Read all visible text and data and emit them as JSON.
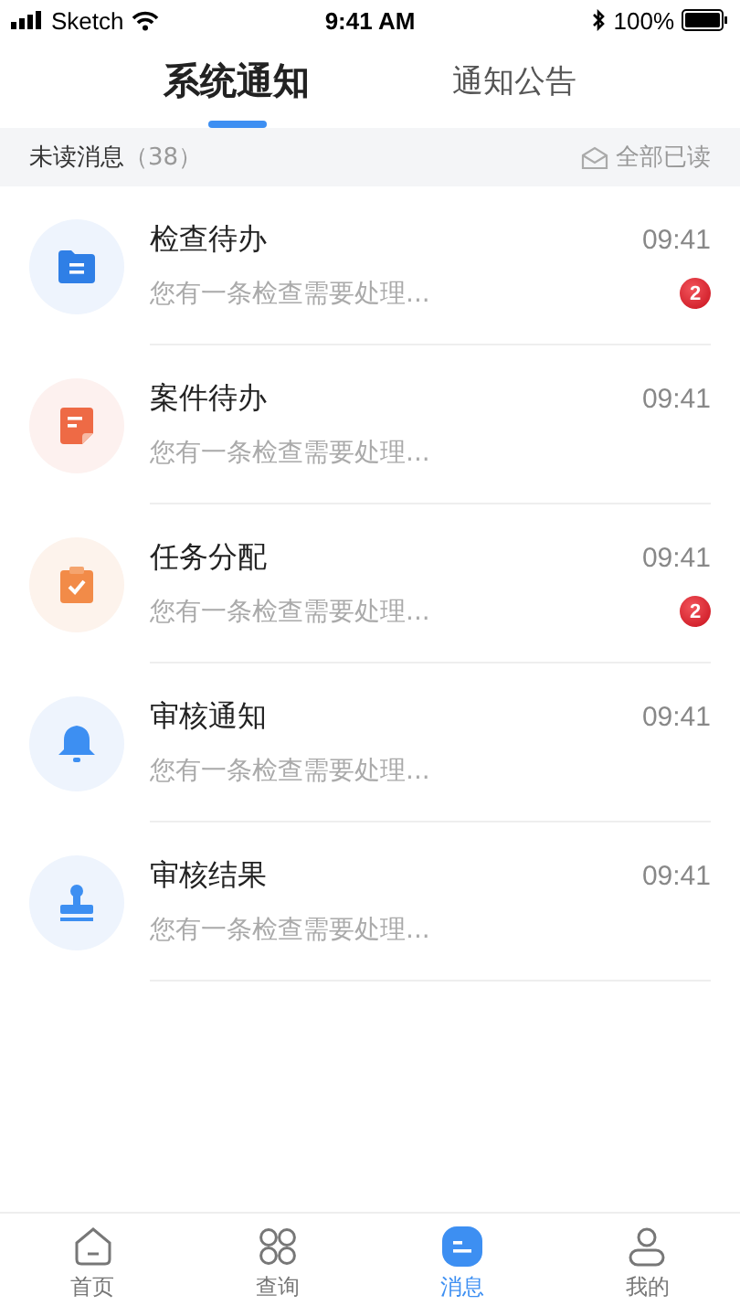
{
  "status_bar": {
    "carrier": "Sketch",
    "time": "9:41 AM",
    "battery": "100%"
  },
  "tabs": [
    {
      "label": "系统通知",
      "selected": true
    },
    {
      "label": "通知公告",
      "selected": false
    }
  ],
  "unread_bar": {
    "label": "未读消息",
    "count": "（38）",
    "action": "全部已读"
  },
  "messages": [
    {
      "kind": "folder",
      "title": "检查待办",
      "time": "09:41",
      "preview": "您有一条检查需要处理...",
      "badge": "2"
    },
    {
      "kind": "note",
      "title": "案件待办",
      "time": "09:41",
      "preview": "您有一条检查需要处理..."
    },
    {
      "kind": "clipboard",
      "title": "任务分配",
      "time": "09:41",
      "preview": "您有一条检查需要处理...",
      "badge": "2"
    },
    {
      "kind": "bell",
      "title": "审核通知",
      "time": "09:41",
      "preview": "您有一条检查需要处理..."
    },
    {
      "kind": "stamp",
      "title": "审核结果",
      "time": "09:41",
      "preview": "您有一条检查需要处理..."
    }
  ],
  "bottom_nav": [
    {
      "kind": "home",
      "label": "首页",
      "selected": false
    },
    {
      "kind": "grid",
      "label": "查询",
      "selected": false
    },
    {
      "kind": "message",
      "label": "消息",
      "selected": true
    },
    {
      "kind": "user",
      "label": "我的",
      "selected": false
    }
  ]
}
